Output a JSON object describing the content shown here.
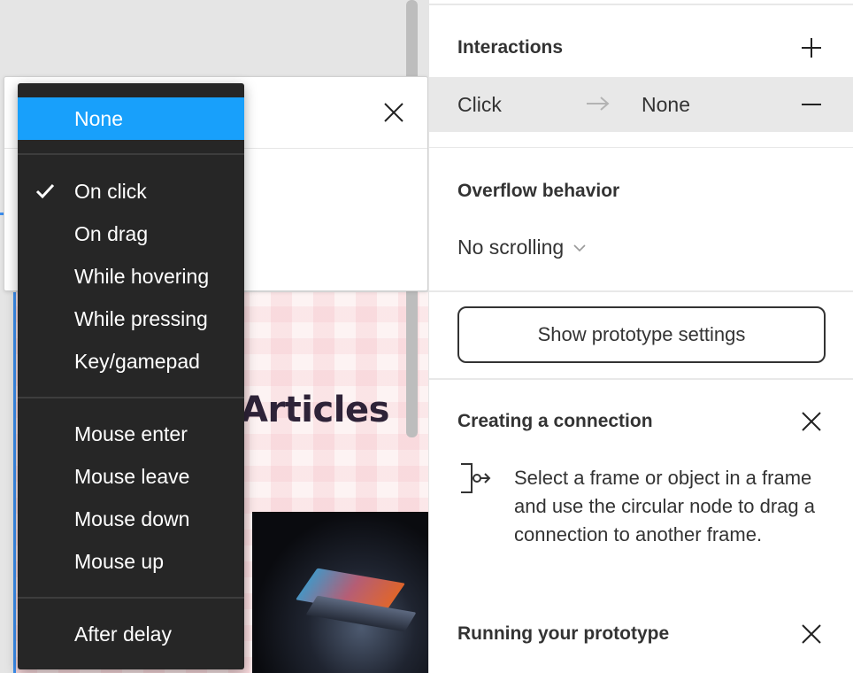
{
  "canvas": {
    "heading": "Articles"
  },
  "menu": {
    "items": [
      {
        "label": "None",
        "selected": true
      },
      {
        "label": "On click",
        "checked": true
      },
      {
        "label": "On drag"
      },
      {
        "label": "While hovering"
      },
      {
        "label": "While pressing"
      },
      {
        "label": "Key/gamepad"
      },
      {
        "label": "Mouse enter"
      },
      {
        "label": "Mouse leave"
      },
      {
        "label": "Mouse down"
      },
      {
        "label": "Mouse up"
      },
      {
        "label": "After delay"
      }
    ]
  },
  "panel": {
    "interactions": {
      "title": "Interactions",
      "row": {
        "trigger": "Click",
        "action": "None"
      }
    },
    "overflow": {
      "title": "Overflow behavior",
      "value": "No scrolling"
    },
    "prototype_button": "Show prototype settings",
    "creating_connection": {
      "title": "Creating a connection",
      "text": "Select a frame or object in a frame and use the circular node to drag a connection to another frame."
    },
    "running_prototype": {
      "title": "Running your prototype"
    }
  },
  "colors": {
    "accent": "#18a0fb",
    "menu_bg": "#262626",
    "row_highlight": "#e8e8e8"
  },
  "icons": [
    "close-icon",
    "checkmark-icon",
    "plus-icon",
    "minus-icon",
    "arrow-right-icon",
    "chevron-down-icon",
    "connection-icon"
  ]
}
